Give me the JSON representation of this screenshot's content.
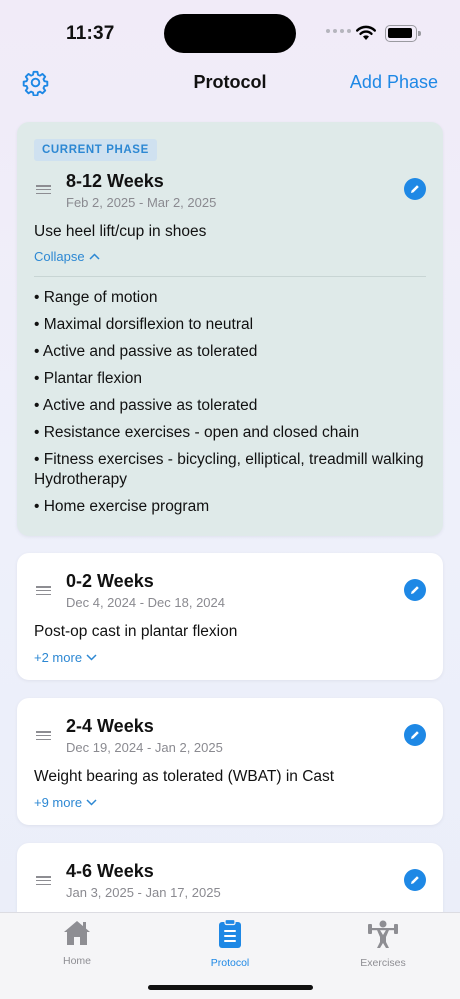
{
  "status_bar": {
    "time": "11:37"
  },
  "nav": {
    "title": "Protocol",
    "add_label": "Add Phase",
    "settings_icon": "gear-icon"
  },
  "colors": {
    "accent": "#1e88e5",
    "current_card_bg": "#dfeae9",
    "badge_bg": "#cfe1f0"
  },
  "phases": [
    {
      "badge": "CURRENT PHASE",
      "title": "8-12 Weeks",
      "dates": "Feb 2, 2025 - Mar 2, 2025",
      "summary": "Use heel lift/cup in shoes",
      "toggle": "Collapse",
      "details": [
        "• Range of motion",
        "• Maximal dorsiflexion to neutral",
        "• Active and passive as tolerated",
        "• Plantar flexion",
        "• Active and passive as tolerated",
        "• Resistance exercises - open and closed chain",
        "• Fitness exercises - bicycling, elliptical, treadmill walking Hydrotherapy",
        "• Home exercise program"
      ]
    },
    {
      "title": "0-2 Weeks",
      "dates": "Dec 4, 2024 - Dec 18, 2024",
      "summary": "Post-op cast in plantar flexion",
      "toggle": "+2 more"
    },
    {
      "title": "2-4 Weeks",
      "dates": "Dec 19, 2024 - Jan 2, 2025",
      "summary": "Weight bearing as tolerated (WBAT) in Cast",
      "toggle": "+9 more"
    },
    {
      "title": "4-6 Weeks",
      "dates": "Jan 3, 2025 - Jan 17, 2025"
    }
  ],
  "tabs": [
    {
      "label": "Home",
      "icon": "house-icon"
    },
    {
      "label": "Protocol",
      "icon": "clipboard-icon",
      "selected": true
    },
    {
      "label": "Exercises",
      "icon": "weightlifter-icon"
    }
  ]
}
